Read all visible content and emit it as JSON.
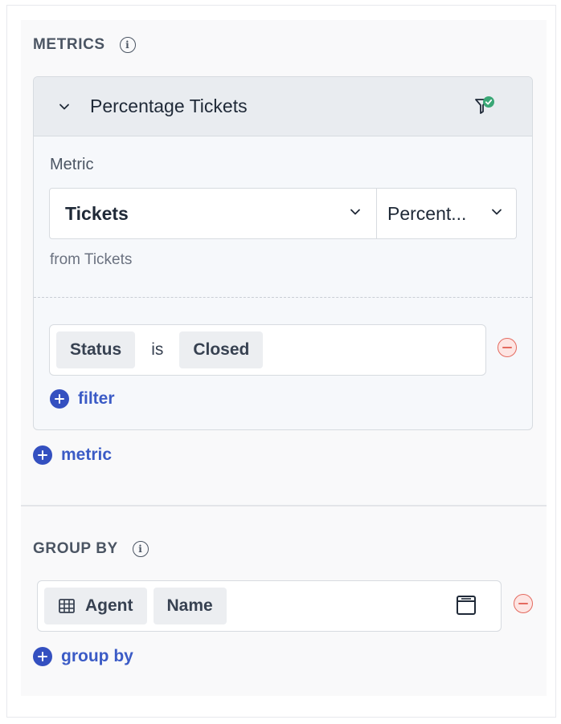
{
  "metrics": {
    "section_title": "METRICS",
    "card": {
      "title": "Percentage Tickets",
      "metric_label": "Metric",
      "metric_value": "Tickets",
      "aggregation_value": "Percent...",
      "source_text": "from Tickets",
      "filter": {
        "field": "Status",
        "operator": "is",
        "value": "Closed"
      },
      "add_filter_label": "filter"
    },
    "add_metric_label": "metric"
  },
  "group_by": {
    "section_title": "GROUP BY",
    "item": {
      "table": "Agent",
      "column": "Name"
    },
    "add_label": "group by"
  },
  "icons": {
    "info": "info-icon",
    "collapse": "chevron-down-icon",
    "filter_status": "filter-check-icon",
    "remove": "minus-circle-icon",
    "add": "plus-circle-icon",
    "table": "table-icon",
    "panel": "panel-icon"
  },
  "colors": {
    "accent": "#3450c0",
    "remove": "#e46a5f",
    "success": "#3aa776"
  }
}
